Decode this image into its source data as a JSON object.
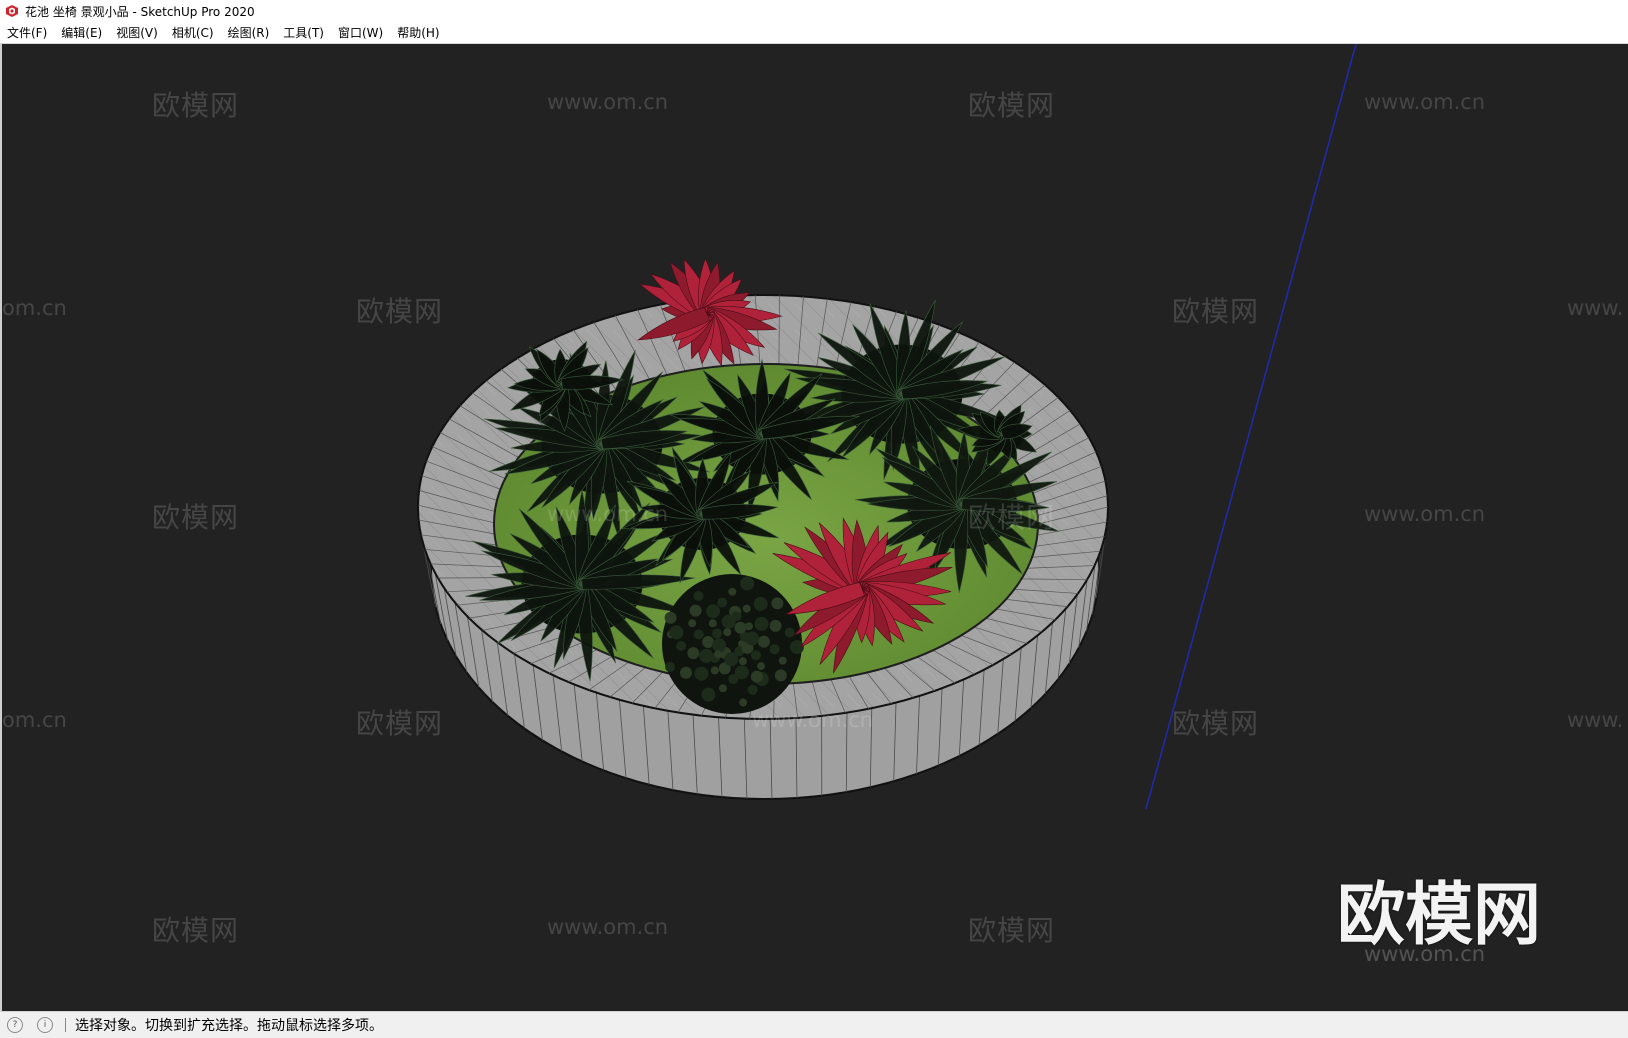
{
  "window": {
    "title": "花池 坐椅 景观小品 - SketchUp Pro 2020",
    "icon": "sketchup-logo-icon"
  },
  "menu": [
    {
      "id": "file",
      "label": "文件(F)"
    },
    {
      "id": "edit",
      "label": "编辑(E)"
    },
    {
      "id": "view",
      "label": "视图(V)"
    },
    {
      "id": "camera",
      "label": "相机(C)"
    },
    {
      "id": "draw",
      "label": "绘图(R)"
    },
    {
      "id": "tools",
      "label": "工具(T)"
    },
    {
      "id": "window",
      "label": "窗口(W)"
    },
    {
      "id": "help",
      "label": "帮助(H)"
    }
  ],
  "watermark": {
    "brand": "欧模网",
    "url": "www.om.cn",
    "url_partial_left": "om.cn",
    "url_partial_right": "www."
  },
  "status": {
    "text": "选择对象。切换到扩充选择。拖动鼠标选择多项。",
    "icons": [
      "geo-location-icon",
      "info-icon"
    ]
  },
  "colors": {
    "viewport_bg": "#222222",
    "grass": "#6f9a3a",
    "planter_stone": "#9a9a9a",
    "axis_blue": "#1f2aa8",
    "bromeliad_red": "#b0223a"
  }
}
